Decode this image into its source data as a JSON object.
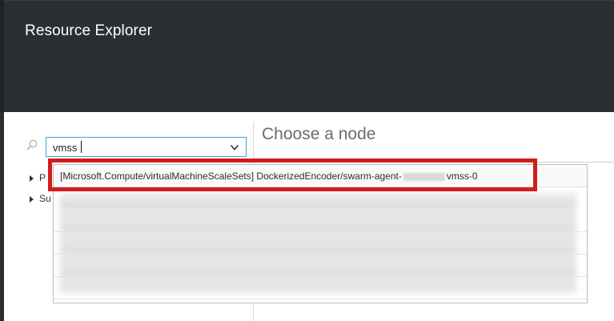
{
  "app": {
    "title": "Resource Explorer"
  },
  "search": {
    "value": "vmss"
  },
  "tree": {
    "items": [
      {
        "label": "P"
      },
      {
        "label": "Su"
      }
    ]
  },
  "main": {
    "heading": "Choose a node"
  },
  "dropdown": {
    "first_result": {
      "prefix": "[Microsoft.Compute/virtualMachineScaleSets] DockerizedEncoder/swarm-agent-",
      "suffix": "vmss-0"
    },
    "blurred_result_count": 5
  },
  "colors": {
    "header_bg": "#2b2f33",
    "accent_border": "#3ea2d6",
    "highlight": "#d21d1d"
  },
  "icons": {
    "search": "search-icon",
    "dropdown": "chevron-down-icon",
    "tree_expand": "triangle-right-icon"
  }
}
